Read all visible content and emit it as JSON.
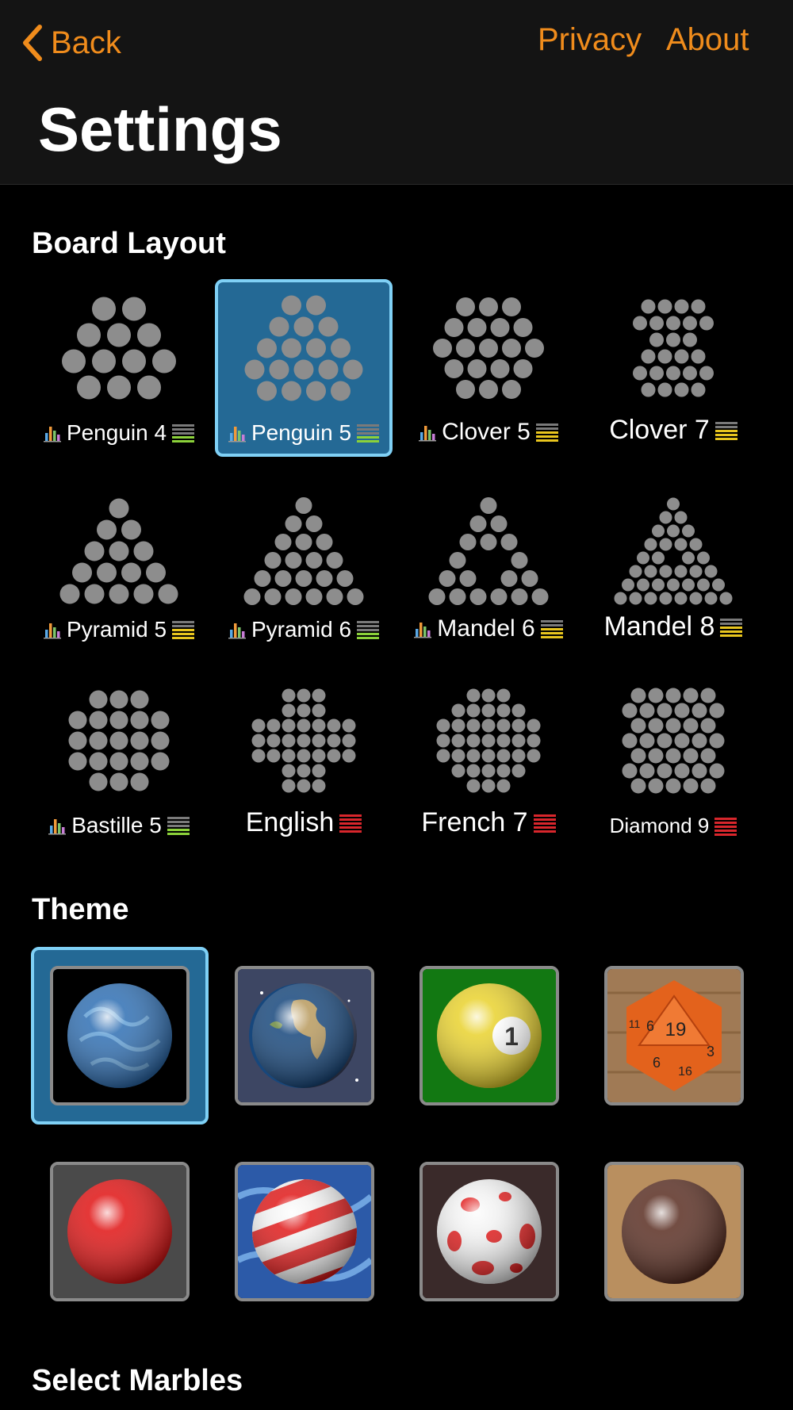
{
  "nav": {
    "back": "Back",
    "privacy": "Privacy",
    "about": "About"
  },
  "title": "Settings",
  "sections": {
    "board": "Board Layout",
    "theme": "Theme",
    "marbles": "Select Marbles"
  },
  "colors": {
    "accent": "#f08c1c",
    "selected_fill": "#246995",
    "selected_border": "#7fd0f5",
    "diff_green": "#8bd13a",
    "diff_yellow": "#e8c51e",
    "diff_red": "#d8262c"
  },
  "boards": [
    {
      "name": "Penguin 4",
      "difficulty": "green",
      "stats_icon": true,
      "selected": false
    },
    {
      "name": "Penguin 5",
      "difficulty": "green",
      "stats_icon": true,
      "selected": true
    },
    {
      "name": "Clover 5",
      "difficulty": "yellow",
      "stats_icon": true,
      "selected": false
    },
    {
      "name": "Clover 7",
      "difficulty": "yellow",
      "stats_icon": false,
      "selected": false
    },
    {
      "name": "Pyramid 5",
      "difficulty": "yellow",
      "stats_icon": true,
      "selected": false
    },
    {
      "name": "Pyramid 6",
      "difficulty": "green",
      "stats_icon": true,
      "selected": false
    },
    {
      "name": "Mandel 6",
      "difficulty": "yellow",
      "stats_icon": true,
      "selected": false
    },
    {
      "name": "Mandel 8",
      "difficulty": "yellow",
      "stats_icon": false,
      "selected": false
    },
    {
      "name": "Bastille 5",
      "difficulty": "green",
      "stats_icon": true,
      "selected": false
    },
    {
      "name": "English",
      "difficulty": "red",
      "stats_icon": false,
      "selected": false
    },
    {
      "name": "French 7",
      "difficulty": "red",
      "stats_icon": false,
      "selected": false
    },
    {
      "name": "Diamond 9",
      "difficulty": "red",
      "stats_icon": false,
      "selected": false
    }
  ],
  "themes": [
    {
      "name": "blue-ornament-marble",
      "selected": true
    },
    {
      "name": "earth-globe",
      "selected": false
    },
    {
      "name": "billiard-ball-1",
      "selected": false,
      "ball_number": "1"
    },
    {
      "name": "orange-d20-die",
      "selected": false,
      "die_numbers": [
        "19",
        "6",
        "3",
        "6",
        "16",
        "11"
      ]
    },
    {
      "name": "red-marble",
      "selected": false
    },
    {
      "name": "red-white-striped-ball",
      "selected": false
    },
    {
      "name": "red-spotted-ball",
      "selected": false
    },
    {
      "name": "brown-wood-ball",
      "selected": false
    }
  ]
}
